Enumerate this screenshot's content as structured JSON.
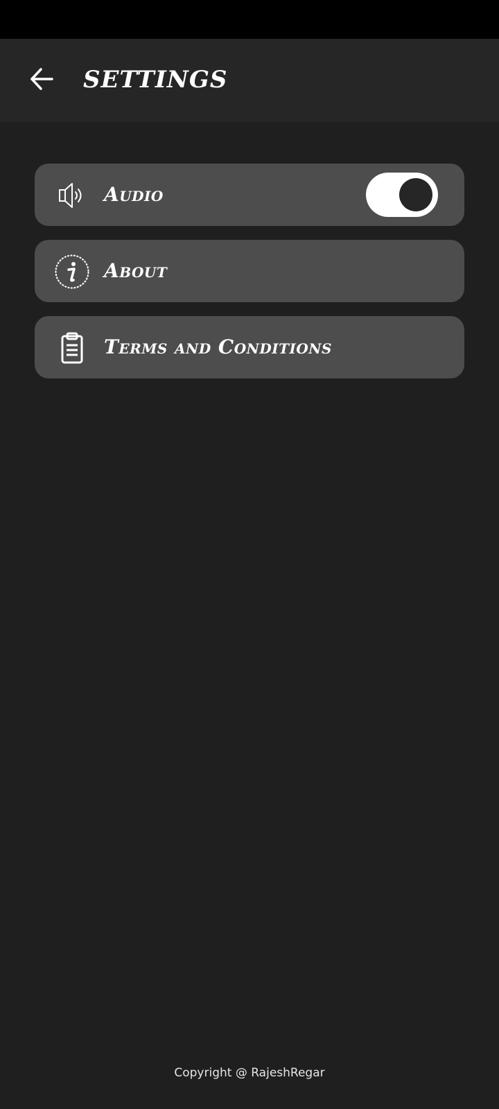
{
  "header": {
    "title": "SETTINGS",
    "back_icon": "arrow-left-icon"
  },
  "settings": {
    "items": [
      {
        "label": "Audio",
        "icon": "speaker-icon",
        "toggle_on": true
      },
      {
        "label": "About",
        "icon": "info-icon"
      },
      {
        "label": "Terms and Conditions",
        "icon": "clipboard-icon"
      }
    ]
  },
  "footer": {
    "copyright": "Copyright @ RajeshRegar"
  },
  "colors": {
    "status_bar": "#000000",
    "app_bar": "#262626",
    "background": "#1f1f1f",
    "card": "#4d4d4d",
    "text": "#ffffff",
    "toggle_track": "#ffffff",
    "toggle_knob": "#262626"
  }
}
